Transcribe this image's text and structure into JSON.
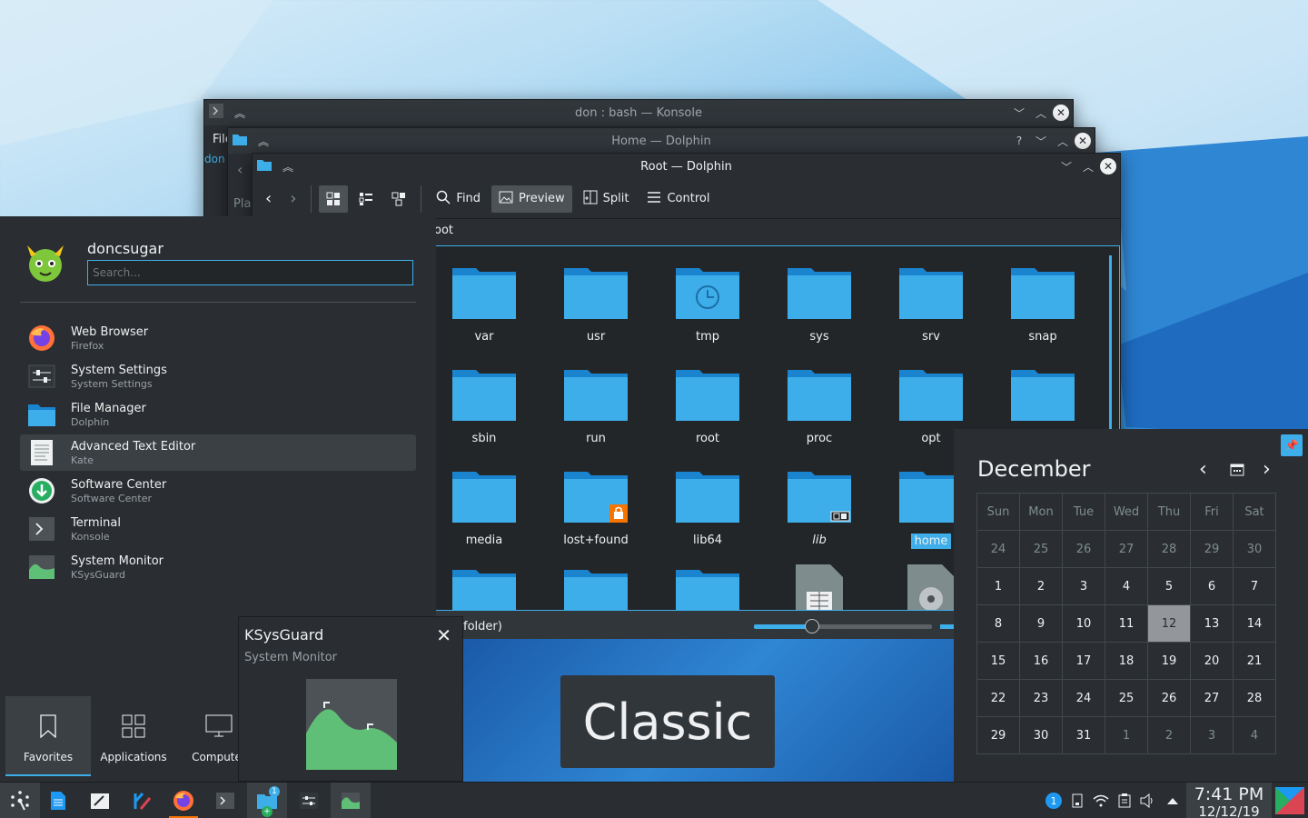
{
  "konsole": {
    "title": "don : bash — Konsole",
    "menu_partial": "File",
    "prompt_partial": "don"
  },
  "dolphin_home": {
    "title": "Home — Dolphin",
    "places_partial": "Plac",
    "help": "?"
  },
  "dolphin_root": {
    "title": "Root — Dolphin",
    "toolbar": {
      "find": "Find",
      "preview": "Preview",
      "split": "Split",
      "control": "Control"
    },
    "location": "oot",
    "status_partial": "folder)",
    "folders": [
      {
        "name": "var"
      },
      {
        "name": "usr"
      },
      {
        "name": "tmp"
      },
      {
        "name": "sys"
      },
      {
        "name": "srv"
      },
      {
        "name": "snap"
      },
      {
        "name": "sbin"
      },
      {
        "name": "run"
      },
      {
        "name": "root"
      },
      {
        "name": "proc"
      },
      {
        "name": "opt"
      },
      {
        "name": ""
      },
      {
        "name": "media"
      },
      {
        "name": "lost+found"
      },
      {
        "name": "lib64"
      },
      {
        "name": "lib"
      },
      {
        "name": "home"
      }
    ]
  },
  "launcher": {
    "username": "doncsugar",
    "search_placeholder": "Search...",
    "favorites": [
      {
        "title": "Web Browser",
        "subtitle": "Firefox",
        "icon": "firefox-icon"
      },
      {
        "title": "System Settings",
        "subtitle": "System Settings",
        "icon": "settings-icon"
      },
      {
        "title": "File Manager",
        "subtitle": "Dolphin",
        "icon": "folder-icon"
      },
      {
        "title": "Advanced Text Editor",
        "subtitle": "Kate",
        "icon": "text-editor-icon"
      },
      {
        "title": "Software Center",
        "subtitle": "Software Center",
        "icon": "software-center-icon"
      },
      {
        "title": "Terminal",
        "subtitle": "Konsole",
        "icon": "terminal-icon"
      },
      {
        "title": "System Monitor",
        "subtitle": "KSysGuard",
        "icon": "system-monitor-icon"
      }
    ],
    "tabs": {
      "favorites": "Favorites",
      "applications": "Applications",
      "computer": "Computer"
    }
  },
  "tooltip": {
    "title": "KSysGuard",
    "subtitle": "System Monitor"
  },
  "wallpaper_preview": {
    "label": "Classic"
  },
  "calendar": {
    "month": "December",
    "weekdays": [
      "Sun",
      "Mon",
      "Tue",
      "Wed",
      "Thu",
      "Fri",
      "Sat"
    ],
    "weeks": [
      [
        "24",
        "25",
        "26",
        "27",
        "28",
        "29",
        "30"
      ],
      [
        "1",
        "2",
        "3",
        "4",
        "5",
        "6",
        "7"
      ],
      [
        "8",
        "9",
        "10",
        "11",
        "12",
        "13",
        "14"
      ],
      [
        "15",
        "16",
        "17",
        "18",
        "19",
        "20",
        "21"
      ],
      [
        "22",
        "23",
        "24",
        "25",
        "26",
        "27",
        "28"
      ],
      [
        "29",
        "30",
        "31",
        "1",
        "2",
        "3",
        "4"
      ]
    ],
    "today": "12"
  },
  "clock": {
    "time": "7:41 PM",
    "date": "12/12/19"
  },
  "taskbar": {
    "badge_count": "1",
    "updates_badge": "1"
  },
  "colors": {
    "accent": "#3daee9",
    "window_bg": "#2a2e32",
    "titlebar": "#31363b",
    "folder": "#3daee9"
  }
}
